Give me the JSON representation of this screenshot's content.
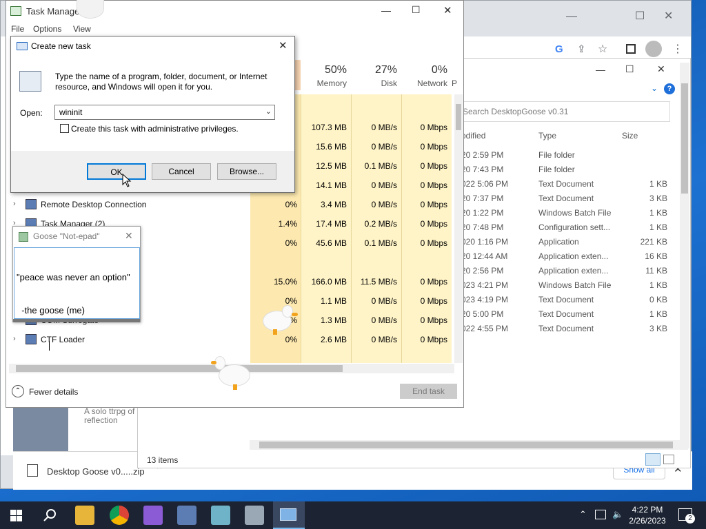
{
  "taskmgr": {
    "title": "Task Manager",
    "menu": [
      "File",
      "Options",
      "View"
    ],
    "columns": {
      "memory": {
        "pct": "50%",
        "label": "Memory"
      },
      "disk": {
        "pct": "27%",
        "label": "Disk"
      },
      "network": {
        "pct": "0%",
        "label": "Network"
      },
      "power": {
        "label": "P"
      }
    },
    "rows": [
      {
        "name": "",
        "cpu": "",
        "memory": "107.3 MB",
        "disk": "0 MB/s",
        "network": "0 Mbps"
      },
      {
        "name": "",
        "cpu": "",
        "memory": "15.6 MB",
        "disk": "0 MB/s",
        "network": "0 Mbps"
      },
      {
        "name": "",
        "cpu": "",
        "memory": "12.5 MB",
        "disk": "0.1 MB/s",
        "network": "0 Mbps"
      },
      {
        "name": "",
        "cpu": "",
        "memory": "14.1 MB",
        "disk": "0 MB/s",
        "network": "0 Mbps"
      },
      {
        "name": "Remote Desktop Connection",
        "cpu": "0%",
        "memory": "3.4 MB",
        "disk": "0 MB/s",
        "network": "0 Mbps"
      },
      {
        "name": "Task Manager (2)",
        "cpu": "1.4%",
        "memory": "17.4 MB",
        "disk": "0.2 MB/s",
        "network": "0 Mbps"
      },
      {
        "name": "",
        "cpu": "0%",
        "memory": "45.6 MB",
        "disk": "0.1 MB/s",
        "network": "0 Mbps"
      },
      {
        "name": "",
        "cpu": "",
        "memory": "",
        "disk": "",
        "network": ""
      },
      {
        "name": "able",
        "cpu": "15.0%",
        "memory": "166.0 MB",
        "disk": "11.5 MB/s",
        "network": "0 Mbps"
      },
      {
        "name": "",
        "cpu": "0%",
        "memory": "1.1 MB",
        "disk": "0 MB/s",
        "network": "0 Mbps"
      },
      {
        "name": "COM Surrogate",
        "cpu": "0%",
        "memory": "1.3 MB",
        "disk": "0 MB/s",
        "network": "0 Mbps"
      },
      {
        "name": "CTF Loader",
        "cpu": "0%",
        "memory": "2.6 MB",
        "disk": "0 MB/s",
        "network": "0 Mbps"
      }
    ],
    "fewer_details": "Fewer details",
    "end_task": "End task"
  },
  "run": {
    "title": "Create new task",
    "description": "Type the name of a program, folder, document, or Internet resource, and Windows will open it for you.",
    "open_label": "Open:",
    "open_value": "wininit",
    "admin_checkbox": "Create this task with administrative privileges.",
    "ok": "OK",
    "cancel": "Cancel",
    "browse": "Browse..."
  },
  "goosepad": {
    "title": "Goose \"Not-epad\"",
    "line1": "\"peace was never an option\"",
    "line2": "  -the goose (me)"
  },
  "explorer": {
    "search_placeholder": "Search DesktopGoose v0.31",
    "headers": {
      "modified": "odified",
      "type": "Type",
      "size": "Size"
    },
    "rows": [
      {
        "date": "20 2:59 PM",
        "type": "File folder",
        "size": ""
      },
      {
        "date": "20 7:43 PM",
        "type": "File folder",
        "size": ""
      },
      {
        "date": "022 5:06 PM",
        "type": "Text Document",
        "size": "1 KB"
      },
      {
        "date": "20 7:37 PM",
        "type": "Text Document",
        "size": "3 KB"
      },
      {
        "date": "20 1:22 PM",
        "type": "Windows Batch File",
        "size": "1 KB"
      },
      {
        "date": "20 7:48 PM",
        "type": "Configuration sett...",
        "size": "1 KB"
      },
      {
        "date": "020 1:16 PM",
        "type": "Application",
        "size": "221 KB"
      },
      {
        "date": "20 12:44 AM",
        "type": "Application exten...",
        "size": "16 KB"
      },
      {
        "date": "20 2:56 PM",
        "type": "Application exten...",
        "size": "11 KB"
      },
      {
        "date": "023 4:21 PM",
        "type": "Windows Batch File",
        "size": "1 KB"
      },
      {
        "date": "023 4:19 PM",
        "type": "Text Document",
        "size": "0 KB"
      },
      {
        "date": "20 5:00 PM",
        "type": "Text Document",
        "size": "1 KB"
      },
      {
        "date": "022 4:55 PM",
        "type": "Text Document",
        "size": "3 KB"
      }
    ],
    "items_count": "13 items"
  },
  "chrome": {
    "page_snippet": "A solo ttrpg of reflection",
    "download_name": "Desktop Goose v0.....zip",
    "show_all": "Show all"
  },
  "taskbar": {
    "time": "4:22 PM",
    "date": "2/26/2023",
    "notif_count": "2"
  },
  "colors": {
    "cpu_highlight": "#fde7a4",
    "taskbar": "#1c2433",
    "accent": "#0078d7"
  }
}
